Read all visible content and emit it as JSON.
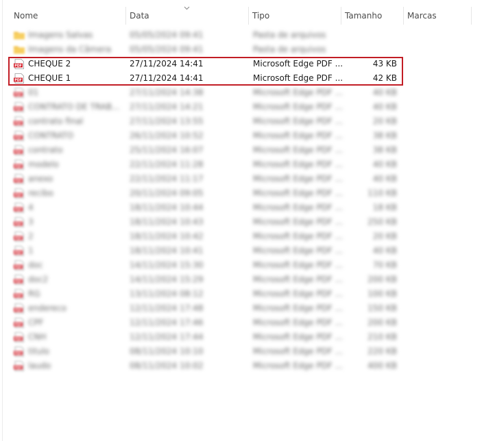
{
  "columns": {
    "name": "Nome",
    "date": "Data",
    "type": "Tipo",
    "size": "Tamanho",
    "tags": "Marcas"
  },
  "colors": {
    "highlight": "#c21d25",
    "pdf_icon": "#d4232d",
    "folder_icon": "#f2c04a"
  },
  "folders": [
    {
      "name": "Imagens Salvas",
      "date": "05/05/2024 09:41",
      "type": "Pasta de arquivos",
      "size": "",
      "icon": "folder-icon"
    },
    {
      "name": "Imagens da Câmera",
      "date": "05/05/2024 09:41",
      "type": "Pasta de arquivos",
      "size": "",
      "icon": "folder-icon"
    }
  ],
  "files": [
    {
      "name": "CHEQUE 2",
      "date": "27/11/2024 14:41",
      "type": "Microsoft Edge PDF ...",
      "size": "43 KB",
      "icon": "pdf-icon",
      "highlighted": true
    },
    {
      "name": "CHEQUE 1",
      "date": "27/11/2024 14:41",
      "type": "Microsoft Edge PDF ...",
      "size": "42 KB",
      "icon": "pdf-icon",
      "highlighted": true
    },
    {
      "name": "01",
      "date": "27/11/2024 14:38",
      "type": "Microsoft Edge PDF ...",
      "size": "40 KB",
      "icon": "pdf-icon"
    },
    {
      "name": "CONTRATO DE TRAB...",
      "date": "27/11/2024 14:21",
      "type": "Microsoft Edge PDF ...",
      "size": "40 KB",
      "icon": "pdf-icon"
    },
    {
      "name": "contrato final",
      "date": "27/11/2024 13:55",
      "type": "Microsoft Edge PDF ...",
      "size": "20 KB",
      "icon": "pdf-icon"
    },
    {
      "name": "CONTRATO",
      "date": "26/11/2024 10:52",
      "type": "Microsoft Edge PDF ...",
      "size": "38 KB",
      "icon": "pdf-icon"
    },
    {
      "name": "contrato",
      "date": "25/11/2024 16:07",
      "type": "Microsoft Edge PDF ...",
      "size": "38 KB",
      "icon": "pdf-icon"
    },
    {
      "name": "modelo",
      "date": "22/11/2024 11:28",
      "type": "Microsoft Edge PDF ...",
      "size": "40 KB",
      "icon": "pdf-icon"
    },
    {
      "name": "anexo",
      "date": "22/11/2024 11:17",
      "type": "Microsoft Edge PDF ...",
      "size": "40 KB",
      "icon": "pdf-icon"
    },
    {
      "name": "recibo",
      "date": "20/11/2024 09:05",
      "type": "Microsoft Edge PDF ...",
      "size": "110 KB",
      "icon": "pdf-icon"
    },
    {
      "name": "4",
      "date": "18/11/2024 10:44",
      "type": "Microsoft Edge PDF ...",
      "size": "18 KB",
      "icon": "pdf-icon"
    },
    {
      "name": "3",
      "date": "18/11/2024 10:43",
      "type": "Microsoft Edge PDF ...",
      "size": "250 KB",
      "icon": "pdf-icon"
    },
    {
      "name": "2",
      "date": "18/11/2024 10:42",
      "type": "Microsoft Edge PDF ...",
      "size": "20 KB",
      "icon": "pdf-icon"
    },
    {
      "name": "1",
      "date": "18/11/2024 10:41",
      "type": "Microsoft Edge PDF ...",
      "size": "40 KB",
      "icon": "pdf-icon"
    },
    {
      "name": "doc",
      "date": "14/11/2024 15:30",
      "type": "Microsoft Edge PDF ...",
      "size": "70 KB",
      "icon": "pdf-icon"
    },
    {
      "name": "doc2",
      "date": "14/11/2024 15:29",
      "type": "Microsoft Edge PDF ...",
      "size": "200 KB",
      "icon": "pdf-icon"
    },
    {
      "name": "RG",
      "date": "13/11/2024 08:12",
      "type": "Microsoft Edge PDF ...",
      "size": "100 KB",
      "icon": "pdf-icon"
    },
    {
      "name": "endereco",
      "date": "12/11/2024 17:48",
      "type": "Microsoft Edge PDF ...",
      "size": "150 KB",
      "icon": "pdf-icon"
    },
    {
      "name": "CPF",
      "date": "12/11/2024 17:46",
      "type": "Microsoft Edge PDF ...",
      "size": "200 KB",
      "icon": "pdf-icon"
    },
    {
      "name": "CNH",
      "date": "12/11/2024 17:44",
      "type": "Microsoft Edge PDF ...",
      "size": "210 KB",
      "icon": "pdf-icon"
    },
    {
      "name": "titulo",
      "date": "08/11/2024 10:10",
      "type": "Microsoft Edge PDF ...",
      "size": "220 KB",
      "icon": "pdf-icon"
    },
    {
      "name": "laudo",
      "date": "08/11/2024 10:02",
      "type": "Microsoft Edge PDF ...",
      "size": "400 KB",
      "icon": "pdf-icon"
    }
  ]
}
